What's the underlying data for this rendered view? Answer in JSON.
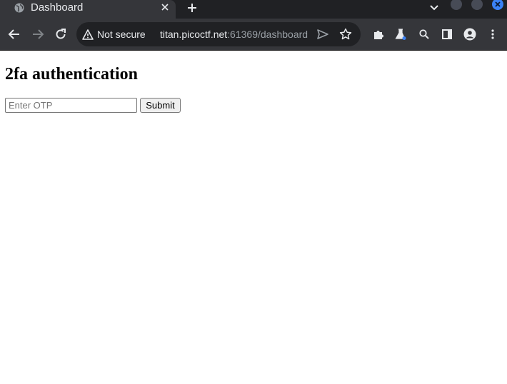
{
  "browser": {
    "tab": {
      "title": "Dashboard",
      "favicon": "globe-icon"
    },
    "omnibox": {
      "security_label": "Not secure",
      "url_host": "titan.picoctf.net",
      "url_rest": ":61369/dashboard"
    },
    "colors": {
      "tabstrip_bg": "#202124",
      "toolbar_bg": "#35363a",
      "omnibox_bg": "#202124",
      "close_accent": "#3b82f6"
    }
  },
  "page": {
    "title": "2fa authentication",
    "otp_input": {
      "placeholder": "Enter OTP",
      "value": ""
    },
    "submit_label": "Submit"
  }
}
